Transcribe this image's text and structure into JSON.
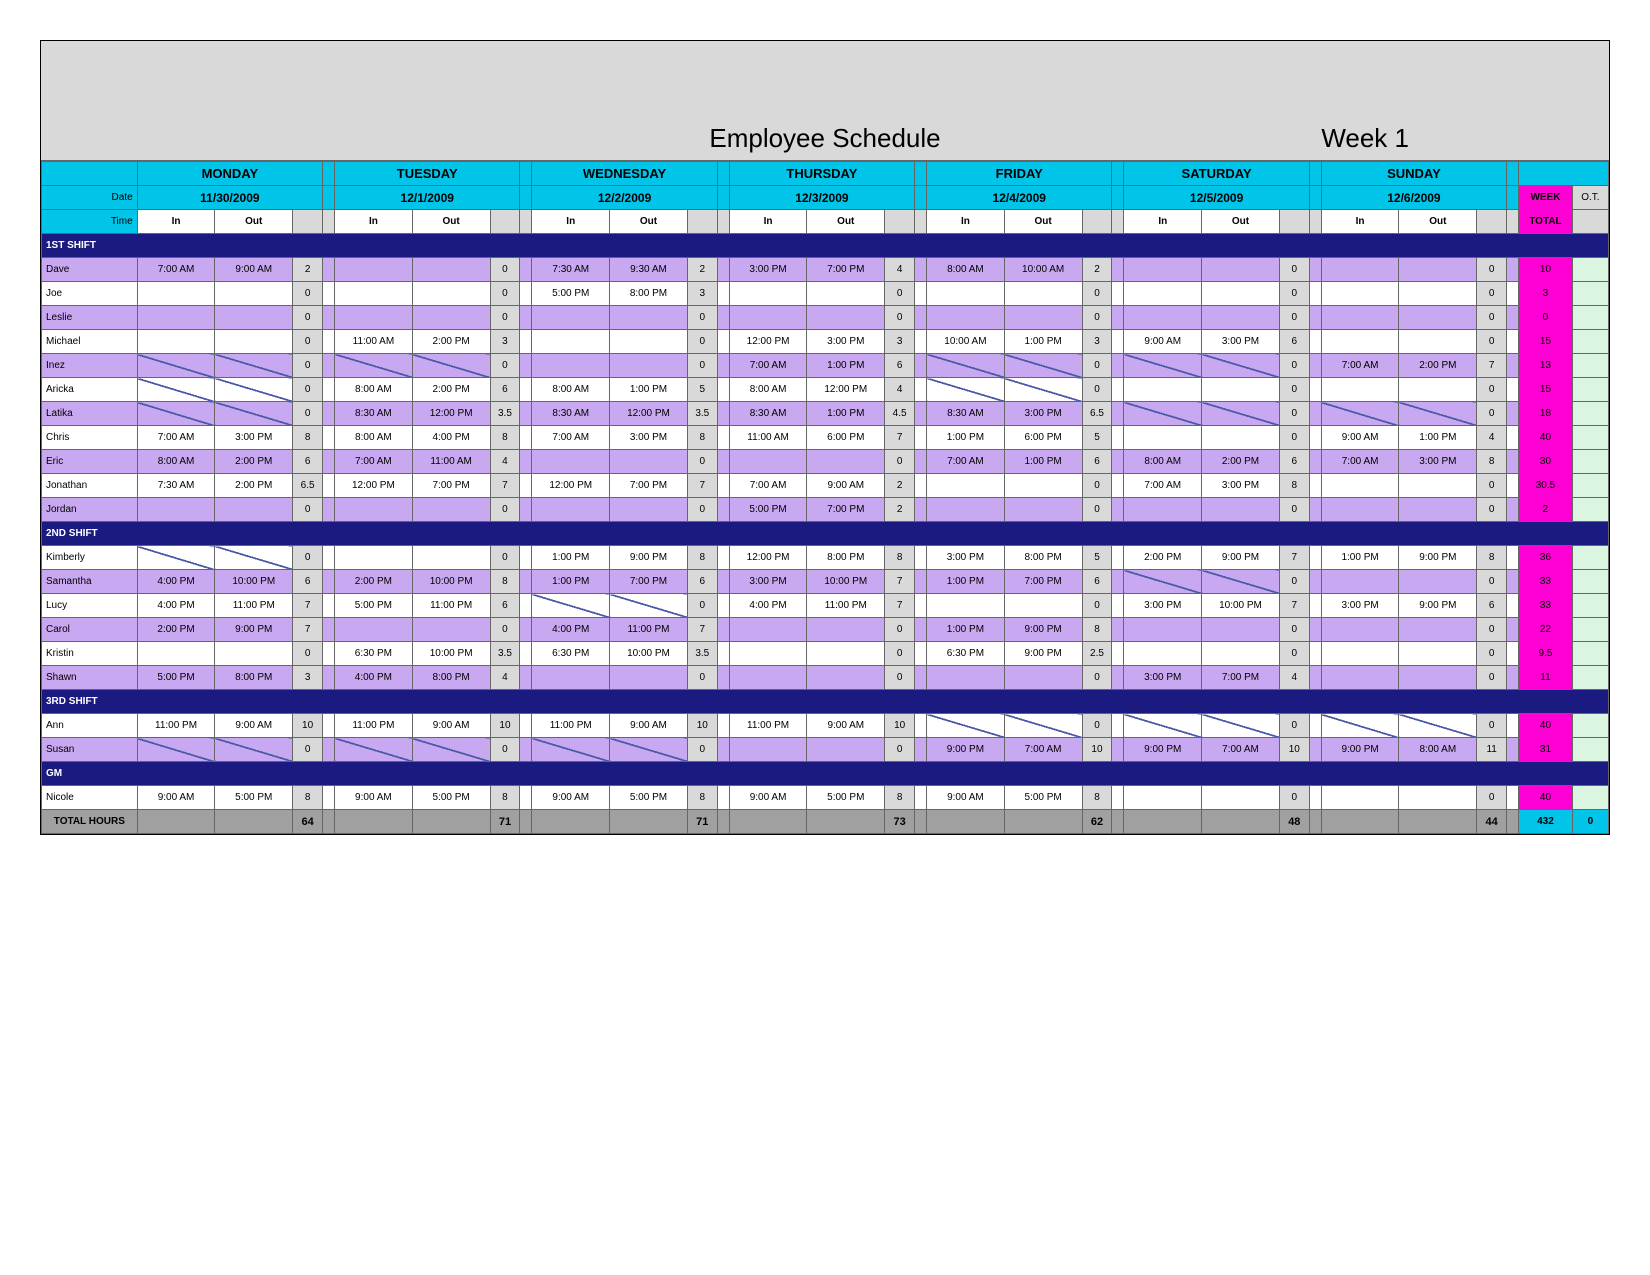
{
  "banner": {
    "title": "Employee Schedule",
    "week": "Week 1"
  },
  "labels": {
    "date": "Date",
    "time": "Time",
    "in": "In",
    "out": "Out",
    "week": "WEEK",
    "ot": "O.T.",
    "total": "TOTAL",
    "totalHours": "TOTAL HOURS"
  },
  "days": [
    {
      "name": "MONDAY",
      "date": "11/30/2009"
    },
    {
      "name": "TUESDAY",
      "date": "12/1/2009"
    },
    {
      "name": "WEDNESDAY",
      "date": "12/2/2009"
    },
    {
      "name": "THURSDAY",
      "date": "12/3/2009"
    },
    {
      "name": "FRIDAY",
      "date": "12/4/2009"
    },
    {
      "name": "SATURDAY",
      "date": "12/5/2009"
    },
    {
      "name": "SUNDAY",
      "date": "12/6/2009"
    }
  ],
  "sections": [
    {
      "title": "1ST SHIFT",
      "rows": [
        {
          "name": "Dave",
          "alt": false,
          "c": [
            [
              "7:00 AM",
              "9:00 AM",
              "2",
              ""
            ],
            [
              "",
              "",
              "0",
              ""
            ],
            [
              "7:30 AM",
              "9:30 AM",
              "2",
              ""
            ],
            [
              "3:00 PM",
              "7:00 PM",
              "4",
              ""
            ],
            [
              "8:00 AM",
              "10:00 AM",
              "2",
              ""
            ],
            [
              "",
              "",
              "0",
              ""
            ],
            [
              "",
              "",
              "0",
              ""
            ]
          ],
          "wk": "10",
          "ot": ""
        },
        {
          "name": "Joe",
          "alt": true,
          "c": [
            [
              "",
              "",
              "0",
              ""
            ],
            [
              "",
              "",
              "0",
              ""
            ],
            [
              "5:00 PM",
              "8:00 PM",
              "3",
              ""
            ],
            [
              "",
              "",
              "0",
              ""
            ],
            [
              "",
              "",
              "0",
              ""
            ],
            [
              "",
              "",
              "0",
              ""
            ],
            [
              "",
              "",
              "0",
              ""
            ]
          ],
          "wk": "3",
          "ot": ""
        },
        {
          "name": "Leslie",
          "alt": false,
          "c": [
            [
              "",
              "",
              "0",
              ""
            ],
            [
              "",
              "",
              "0",
              ""
            ],
            [
              "",
              "",
              "0",
              ""
            ],
            [
              "",
              "",
              "0",
              ""
            ],
            [
              "",
              "",
              "0",
              ""
            ],
            [
              "",
              "",
              "0",
              ""
            ],
            [
              "",
              "",
              "0",
              ""
            ]
          ],
          "wk": "0",
          "ot": ""
        },
        {
          "name": "Michael",
          "alt": true,
          "c": [
            [
              "",
              "",
              "0",
              ""
            ],
            [
              "11:00 AM",
              "2:00 PM",
              "3",
              ""
            ],
            [
              "",
              "",
              "0",
              ""
            ],
            [
              "12:00 PM",
              "3:00 PM",
              "3",
              ""
            ],
            [
              "10:00 AM",
              "1:00 PM",
              "3",
              ""
            ],
            [
              "9:00 AM",
              "3:00 PM",
              "6",
              ""
            ],
            [
              "",
              "",
              "0",
              ""
            ]
          ],
          "wk": "15",
          "ot": ""
        },
        {
          "name": "Inez",
          "alt": false,
          "c": [
            [
              "/",
              "/",
              "0",
              ""
            ],
            [
              "/",
              "/",
              "0",
              ""
            ],
            [
              "",
              "",
              "0",
              ""
            ],
            [
              "7:00 AM",
              "1:00 PM",
              "6",
              ""
            ],
            [
              "/",
              "/",
              "0",
              ""
            ],
            [
              "/",
              "/",
              "0",
              ""
            ],
            [
              "7:00 AM",
              "2:00 PM",
              "7",
              ""
            ]
          ],
          "wk": "13",
          "ot": ""
        },
        {
          "name": "Aricka",
          "alt": true,
          "c": [
            [
              "/",
              "/",
              "0",
              ""
            ],
            [
              "8:00 AM",
              "2:00 PM",
              "6",
              ""
            ],
            [
              "8:00 AM",
              "1:00 PM",
              "5",
              ""
            ],
            [
              "8:00 AM",
              "12:00 PM",
              "4",
              ""
            ],
            [
              "/",
              "/",
              "0",
              ""
            ],
            [
              "",
              "",
              "0",
              ""
            ],
            [
              "",
              "",
              "0",
              ""
            ]
          ],
          "wk": "15",
          "ot": ""
        },
        {
          "name": "Latika",
          "alt": false,
          "c": [
            [
              "/",
              "/",
              "0",
              ""
            ],
            [
              "8:30 AM",
              "12:00 PM",
              "3.5",
              ""
            ],
            [
              "8:30 AM",
              "12:00 PM",
              "3.5",
              ""
            ],
            [
              "8:30 AM",
              "1:00 PM",
              "4.5",
              ""
            ],
            [
              "8:30 AM",
              "3:00 PM",
              "6.5",
              ""
            ],
            [
              "/",
              "/",
              "0",
              ""
            ],
            [
              "/",
              "/",
              "0",
              ""
            ]
          ],
          "wk": "18",
          "ot": ""
        },
        {
          "name": "Chris",
          "alt": true,
          "c": [
            [
              "7:00 AM",
              "3:00 PM",
              "8",
              ""
            ],
            [
              "8:00 AM",
              "4:00 PM",
              "8",
              ""
            ],
            [
              "7:00 AM",
              "3:00 PM",
              "8",
              ""
            ],
            [
              "11:00 AM",
              "6:00 PM",
              "7",
              ""
            ],
            [
              "1:00 PM",
              "6:00 PM",
              "5",
              ""
            ],
            [
              "",
              "",
              "0",
              ""
            ],
            [
              "9:00 AM",
              "1:00 PM",
              "4",
              ""
            ]
          ],
          "wk": "40",
          "ot": ""
        },
        {
          "name": "Eric",
          "alt": false,
          "c": [
            [
              "8:00 AM",
              "2:00 PM",
              "6",
              ""
            ],
            [
              "7:00 AM",
              "11:00 AM",
              "4",
              ""
            ],
            [
              "",
              "",
              "0",
              ""
            ],
            [
              "",
              "",
              "0",
              ""
            ],
            [
              "7:00 AM",
              "1:00 PM",
              "6",
              ""
            ],
            [
              "8:00 AM",
              "2:00 PM",
              "6",
              ""
            ],
            [
              "7:00 AM",
              "3:00 PM",
              "8",
              ""
            ]
          ],
          "wk": "30",
          "ot": ""
        },
        {
          "name": "Jonathan",
          "alt": true,
          "c": [
            [
              "7:30 AM",
              "2:00 PM",
              "6.5",
              ""
            ],
            [
              "12:00 PM",
              "7:00 PM",
              "7",
              ""
            ],
            [
              "12:00 PM",
              "7:00 PM",
              "7",
              ""
            ],
            [
              "7:00 AM",
              "9:00 AM",
              "2",
              ""
            ],
            [
              "",
              "",
              "0",
              ""
            ],
            [
              "7:00 AM",
              "3:00 PM",
              "8",
              ""
            ],
            [
              "",
              "",
              "0",
              ""
            ]
          ],
          "wk": "30.5",
          "ot": ""
        },
        {
          "name": "Jordan",
          "alt": false,
          "c": [
            [
              "",
              "",
              "0",
              ""
            ],
            [
              "",
              "",
              "0",
              ""
            ],
            [
              "",
              "",
              "0",
              ""
            ],
            [
              "5:00 PM",
              "7:00 PM",
              "2",
              ""
            ],
            [
              "",
              "",
              "0",
              ""
            ],
            [
              "",
              "",
              "0",
              ""
            ],
            [
              "",
              "",
              "0",
              ""
            ]
          ],
          "wk": "2",
          "ot": ""
        }
      ]
    },
    {
      "title": "2ND SHIFT",
      "rows": [
        {
          "name": "Kimberly",
          "alt": true,
          "c": [
            [
              "/",
              "/",
              "0",
              ""
            ],
            [
              "",
              "",
              "0",
              ""
            ],
            [
              "1:00 PM",
              "9:00 PM",
              "8",
              ""
            ],
            [
              "12:00 PM",
              "8:00 PM",
              "8",
              ""
            ],
            [
              "3:00 PM",
              "8:00 PM",
              "5",
              ""
            ],
            [
              "2:00 PM",
              "9:00 PM",
              "7",
              ""
            ],
            [
              "1:00 PM",
              "9:00 PM",
              "8",
              ""
            ]
          ],
          "wk": "36",
          "ot": ""
        },
        {
          "name": "Samantha",
          "alt": false,
          "c": [
            [
              "4:00 PM",
              "10:00 PM",
              "6",
              ""
            ],
            [
              "2:00 PM",
              "10:00 PM",
              "8",
              ""
            ],
            [
              "1:00 PM",
              "7:00 PM",
              "6",
              ""
            ],
            [
              "3:00 PM",
              "10:00 PM",
              "7",
              ""
            ],
            [
              "1:00 PM",
              "7:00 PM",
              "6",
              ""
            ],
            [
              "/",
              "/",
              "0",
              ""
            ],
            [
              "",
              "",
              "0",
              ""
            ]
          ],
          "wk": "33",
          "ot": ""
        },
        {
          "name": "Lucy",
          "alt": true,
          "c": [
            [
              "4:00 PM",
              "11:00 PM",
              "7",
              ""
            ],
            [
              "5:00 PM",
              "11:00 PM",
              "6",
              ""
            ],
            [
              "/",
              "/",
              "0",
              ""
            ],
            [
              "4:00 PM",
              "11:00 PM",
              "7",
              ""
            ],
            [
              "",
              "",
              "0",
              ""
            ],
            [
              "3:00 PM",
              "10:00 PM",
              "7",
              ""
            ],
            [
              "3:00 PM",
              "9:00 PM",
              "6",
              ""
            ]
          ],
          "wk": "33",
          "ot": ""
        },
        {
          "name": "Carol",
          "alt": false,
          "c": [
            [
              "2:00 PM",
              "9:00 PM",
              "7",
              ""
            ],
            [
              "",
              "",
              "0",
              ""
            ],
            [
              "4:00 PM",
              "11:00 PM",
              "7",
              ""
            ],
            [
              "",
              "",
              "0",
              ""
            ],
            [
              "1:00 PM",
              "9:00 PM",
              "8",
              ""
            ],
            [
              "",
              "",
              "0",
              ""
            ],
            [
              "",
              "",
              "0",
              ""
            ]
          ],
          "wk": "22",
          "ot": ""
        },
        {
          "name": "Kristin",
          "alt": true,
          "c": [
            [
              "",
              "",
              "0",
              ""
            ],
            [
              "6:30 PM",
              "10:00 PM",
              "3.5",
              ""
            ],
            [
              "6:30 PM",
              "10:00 PM",
              "3.5",
              ""
            ],
            [
              "",
              "",
              "0",
              ""
            ],
            [
              "6:30 PM",
              "9:00 PM",
              "2.5",
              ""
            ],
            [
              "",
              "",
              "0",
              ""
            ],
            [
              "",
              "",
              "0",
              ""
            ]
          ],
          "wk": "9.5",
          "ot": ""
        },
        {
          "name": "Shawn",
          "alt": false,
          "c": [
            [
              "5:00 PM",
              "8:00 PM",
              "3",
              ""
            ],
            [
              "4:00 PM",
              "8:00 PM",
              "4",
              ""
            ],
            [
              "",
              "",
              "0",
              ""
            ],
            [
              "",
              "",
              "0",
              ""
            ],
            [
              "",
              "",
              "0",
              ""
            ],
            [
              "3:00 PM",
              "7:00 PM",
              "4",
              ""
            ],
            [
              "",
              "",
              "0",
              ""
            ]
          ],
          "wk": "11",
          "ot": ""
        }
      ]
    },
    {
      "title": "3RD SHIFT",
      "rows": [
        {
          "name": "Ann",
          "alt": true,
          "c": [
            [
              "11:00 PM",
              "9:00 AM",
              "10",
              ""
            ],
            [
              "11:00 PM",
              "9:00 AM",
              "10",
              ""
            ],
            [
              "11:00 PM",
              "9:00 AM",
              "10",
              ""
            ],
            [
              "11:00 PM",
              "9:00 AM",
              "10",
              ""
            ],
            [
              "/",
              "/",
              "0",
              ""
            ],
            [
              "/",
              "/",
              "0",
              ""
            ],
            [
              "/",
              "/",
              "0",
              ""
            ]
          ],
          "wk": "40",
          "ot": ""
        },
        {
          "name": "Susan",
          "alt": false,
          "c": [
            [
              "/",
              "/",
              "0",
              ""
            ],
            [
              "/",
              "/",
              "0",
              ""
            ],
            [
              "/",
              "/",
              "0",
              ""
            ],
            [
              "",
              "",
              "0",
              ""
            ],
            [
              "9:00 PM",
              "7:00 AM",
              "10",
              ""
            ],
            [
              "9:00 PM",
              "7:00 AM",
              "10",
              ""
            ],
            [
              "9:00 PM",
              "8:00 AM",
              "11",
              ""
            ]
          ],
          "wk": "31",
          "ot": ""
        }
      ]
    },
    {
      "title": "GM",
      "rows": [
        {
          "name": "Nicole",
          "alt": true,
          "c": [
            [
              "9:00 AM",
              "5:00 PM",
              "8",
              ""
            ],
            [
              "9:00 AM",
              "5:00 PM",
              "8",
              ""
            ],
            [
              "9:00 AM",
              "5:00 PM",
              "8",
              ""
            ],
            [
              "9:00 AM",
              "5:00 PM",
              "8",
              ""
            ],
            [
              "9:00 AM",
              "5:00 PM",
              "8",
              ""
            ],
            [
              "",
              "",
              "0",
              ""
            ],
            [
              "",
              "",
              "0",
              ""
            ]
          ],
          "wk": "40",
          "ot": ""
        }
      ]
    }
  ],
  "totals": {
    "days": [
      "64",
      "71",
      "71",
      "73",
      "62",
      "48",
      "44"
    ],
    "grand": "432",
    "ot": "0"
  }
}
